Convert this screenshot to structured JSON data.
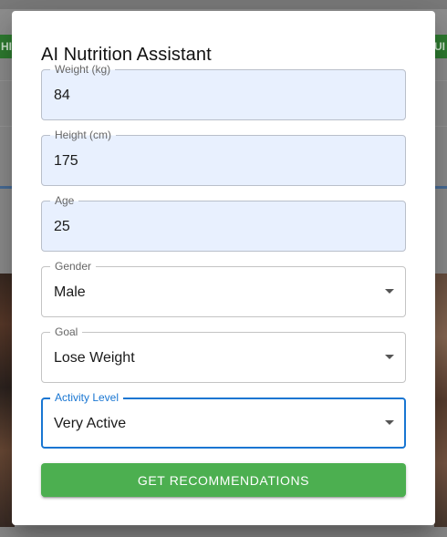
{
  "background": {
    "left_tab_text": "HI",
    "right_tab_text": "UI"
  },
  "dialog": {
    "title": "AI Nutrition Assistant",
    "fields": {
      "weight": {
        "label": "Weight (kg)",
        "value": "84"
      },
      "height": {
        "label": "Height (cm)",
        "value": "175"
      },
      "age": {
        "label": "Age",
        "value": "25"
      },
      "gender": {
        "label": "Gender",
        "value": "Male"
      },
      "goal": {
        "label": "Goal",
        "value": "Lose Weight"
      },
      "activity": {
        "label": "Activity Level",
        "value": "Very Active"
      }
    },
    "submit_label": "Get Recommendations"
  },
  "colors": {
    "accent": "#1976d2",
    "button": "#4caf50",
    "autofill": "#e8f0fe"
  }
}
